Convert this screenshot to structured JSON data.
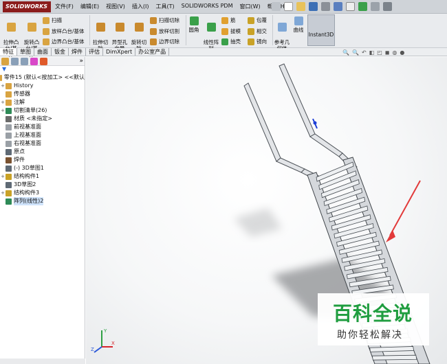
{
  "app": {
    "logo": "SOLIDWORKS"
  },
  "menu": [
    "文件(F)",
    "编辑(E)",
    "视图(V)",
    "插入(I)",
    "工具(T)",
    "SOLIDWORKS PDM",
    "窗口(W)",
    "帮助(H)"
  ],
  "ribbon": {
    "extrude_boss": "拉伸凸\n台/基\n体",
    "revolve_boss": "旋转凸\n台/基\n体",
    "sweep": "扫描",
    "loft": "放样凸台/基体",
    "boundary_boss": "边界凸台/基体",
    "extrude_cut": "拉伸切\n除",
    "hole_wizard": "异型孔\n向导",
    "revolve_cut": "旋转切\n除",
    "swept_cut": "扫描切除",
    "lofted_cut": "放样切割",
    "boundary_cut": "边界切除",
    "fillet": "圆角",
    "linear_pattern": "线性阵\n列",
    "rib": "筋",
    "draft": "拔模",
    "shell": "抽壳",
    "wrap": "包覆",
    "intersect": "相交",
    "mirror": "镜向",
    "reference_geometry": "参考几\n何体",
    "curves": "曲线",
    "instant3d": "Instant3D"
  },
  "tabs": [
    "特征",
    "草图",
    "曲面",
    "钣金",
    "焊件",
    "评估",
    "DimXpert",
    "办公室产品"
  ],
  "feature_tree": {
    "root": "零件15 (默认<按加工> <<默认",
    "items": [
      {
        "label": "History",
        "exp": "+",
        "icon": "history-icon",
        "color": "#d9a441"
      },
      {
        "label": "传感器",
        "exp": "",
        "icon": "sensor-icon",
        "color": "#d9a441"
      },
      {
        "label": "注解",
        "exp": "+",
        "icon": "annotation-icon",
        "color": "#d9a441"
      },
      {
        "label": "切割清单(26)",
        "exp": "+",
        "icon": "cut-list-icon",
        "color": "#2e8b57"
      },
      {
        "label": "材质 <未指定>",
        "exp": "",
        "icon": "material-icon",
        "color": "#6b6b6b"
      },
      {
        "label": "前视基准面",
        "exp": "",
        "icon": "plane-icon",
        "color": "#9aa0a6"
      },
      {
        "label": "上视基准面",
        "exp": "",
        "icon": "plane-icon",
        "color": "#9aa0a6"
      },
      {
        "label": "右视基准面",
        "exp": "",
        "icon": "plane-icon",
        "color": "#9aa0a6"
      },
      {
        "label": "原点",
        "exp": "",
        "icon": "origin-icon",
        "color": "#5f6a75"
      },
      {
        "label": "焊件",
        "exp": "",
        "icon": "weldment-icon",
        "color": "#7a5230"
      },
      {
        "label": "(-) 3D草图1",
        "exp": "",
        "icon": "sketch3d-icon",
        "color": "#5f6a75"
      },
      {
        "label": "结构构件1",
        "exp": "+",
        "icon": "structural-member-icon",
        "color": "#c9a227"
      },
      {
        "label": "3D草图2",
        "exp": "",
        "icon": "sketch3d-icon",
        "color": "#5f6a75"
      },
      {
        "label": "结构构件3",
        "exp": "+",
        "icon": "structural-member-icon",
        "color": "#c9a227"
      },
      {
        "label": "阵列(线性)2",
        "exp": "",
        "icon": "linear-pattern-icon",
        "color": "#2e8b57"
      }
    ]
  },
  "watermark": {
    "main": "百科全说",
    "sub": "助你轻松解决"
  },
  "triad": {
    "x": "X",
    "y": "Y",
    "z": "Z"
  },
  "colors": {
    "accent": "#8b1c1c",
    "annotation_arrow": "#e23a3a",
    "watermark": "#1f9d3f"
  }
}
